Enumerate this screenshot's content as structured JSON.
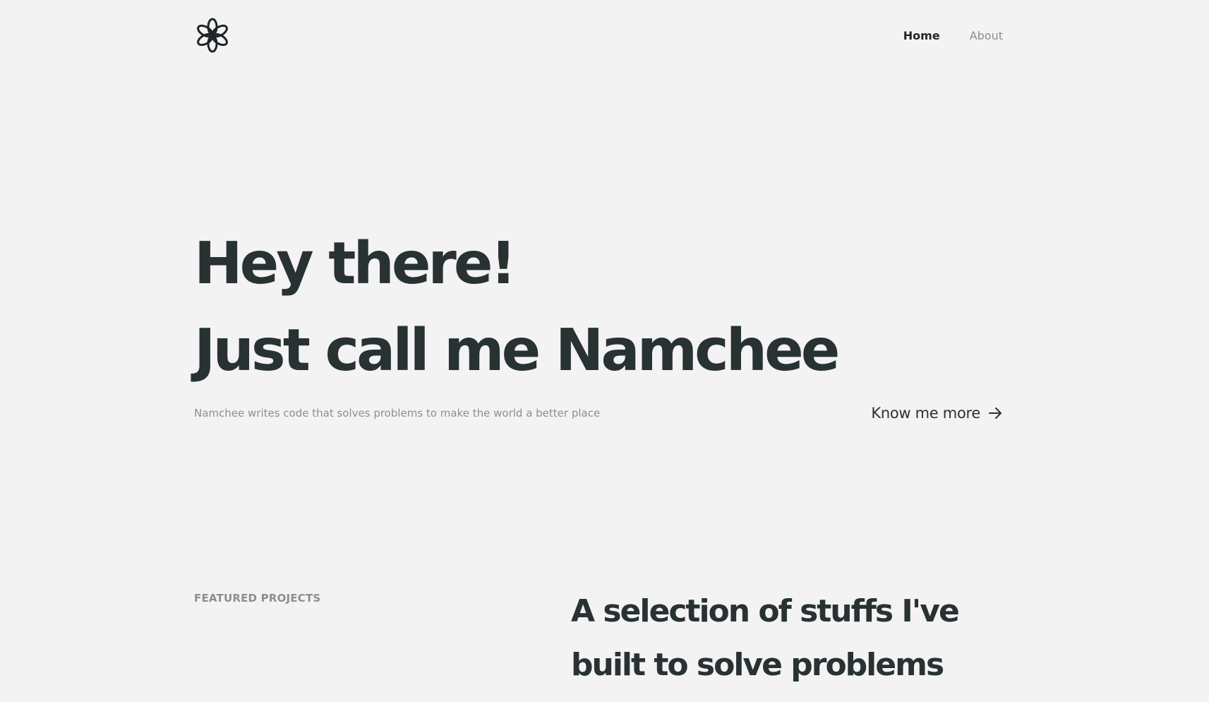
{
  "header": {
    "logo_icon": "flower-logo-icon",
    "nav": [
      {
        "label": "Home",
        "active": true
      },
      {
        "label": "About",
        "active": false
      }
    ]
  },
  "hero": {
    "line1": "Hey there!",
    "line2": "Just call me Namchee",
    "tagline": "Namchee writes code that solves problems to make the world a better place",
    "cta_label": "Know me more",
    "cta_icon": "arrow-right-icon"
  },
  "featured": {
    "label": "FEATURED PROJECTS",
    "title": "A selection of stuffs I've built to solve problems"
  },
  "colors": {
    "background": "#f3f3f3",
    "text": "#293233",
    "muted": "#8a8f90"
  }
}
